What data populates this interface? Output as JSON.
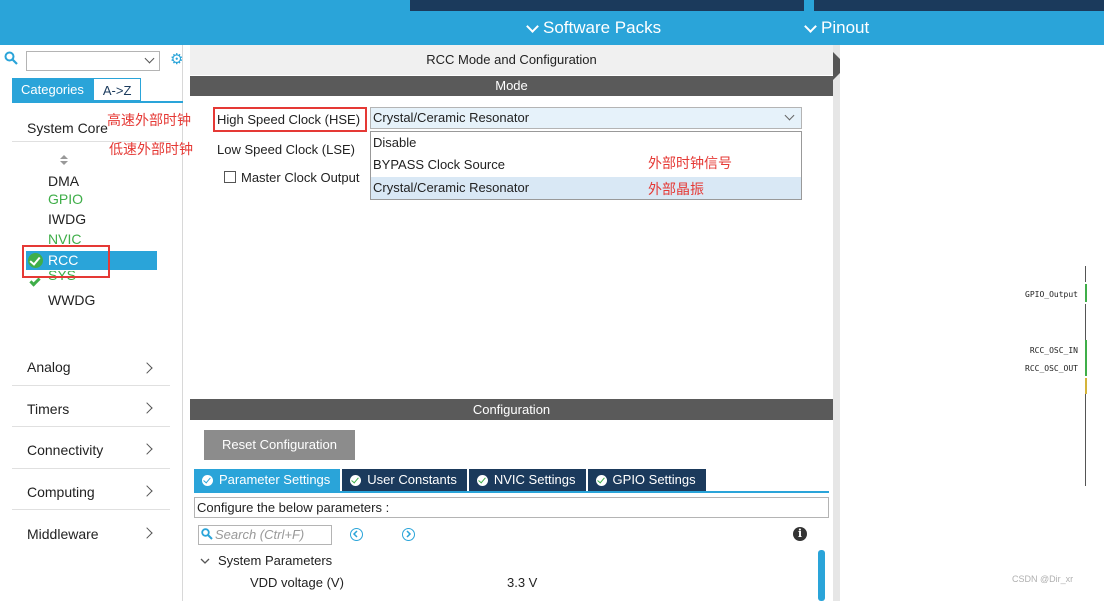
{
  "topbar": {
    "tab_software": "Software Packs",
    "tab_pinout": "Pinout"
  },
  "left": {
    "tabs": [
      "Categories",
      "A->Z"
    ],
    "system_core": "System Core",
    "sub_items": [
      {
        "label": "DMA",
        "color": "#222222"
      },
      {
        "label": "GPIO",
        "color": "#3fae49"
      },
      {
        "label": "IWDG",
        "color": "#222222"
      },
      {
        "label": "NVIC",
        "color": "#3fae49"
      },
      {
        "label": "RCC",
        "selected": true
      },
      {
        "label": "SYS",
        "color": "#3fae49"
      },
      {
        "label": "WWDG",
        "color": "#222222"
      }
    ],
    "categories": [
      "Analog",
      "Timers",
      "Connectivity",
      "Computing",
      "Middleware"
    ]
  },
  "center": {
    "title": "RCC Mode and Configuration",
    "mode_header": "Mode",
    "hse_label": "High Speed Clock (HSE)",
    "lse_label": "Low Speed Clock (LSE)",
    "mco_label": "Master Clock Output",
    "hse_value": "Crystal/Ceramic Resonator",
    "dropdown_options": [
      "Disable",
      "BYPASS Clock Source",
      "Crystal/Ceramic Resonator"
    ],
    "config_header": "Configuration",
    "reset_button": "Reset Configuration",
    "param_tabs": [
      "Parameter Settings",
      "User Constants",
      "NVIC Settings",
      "GPIO Settings"
    ],
    "configure_text": "Configure the below parameters :",
    "search_placeholder": "Search (Ctrl+F)",
    "system_parameters": "System Parameters",
    "vdd_label": "VDD voltage (V)",
    "vdd_value": "3.3 V"
  },
  "annotations": {
    "hse": "高速外部时钟",
    "lse": "低速外部时钟",
    "bypass": "外部时钟信号",
    "crystal": "外部晶振"
  },
  "right": {
    "pins": [
      "GPIO_Output",
      "RCC_OSC_IN",
      "RCC_OSC_OUT"
    ],
    "watermark": "CSDN @Dir_xr"
  },
  "colors": {
    "accent": "#2aa4d9",
    "dark": "#1b3a5c",
    "header_gray": "#5a5a5a",
    "ok_green": "#3fae49",
    "annotation_red": "#e53935"
  }
}
